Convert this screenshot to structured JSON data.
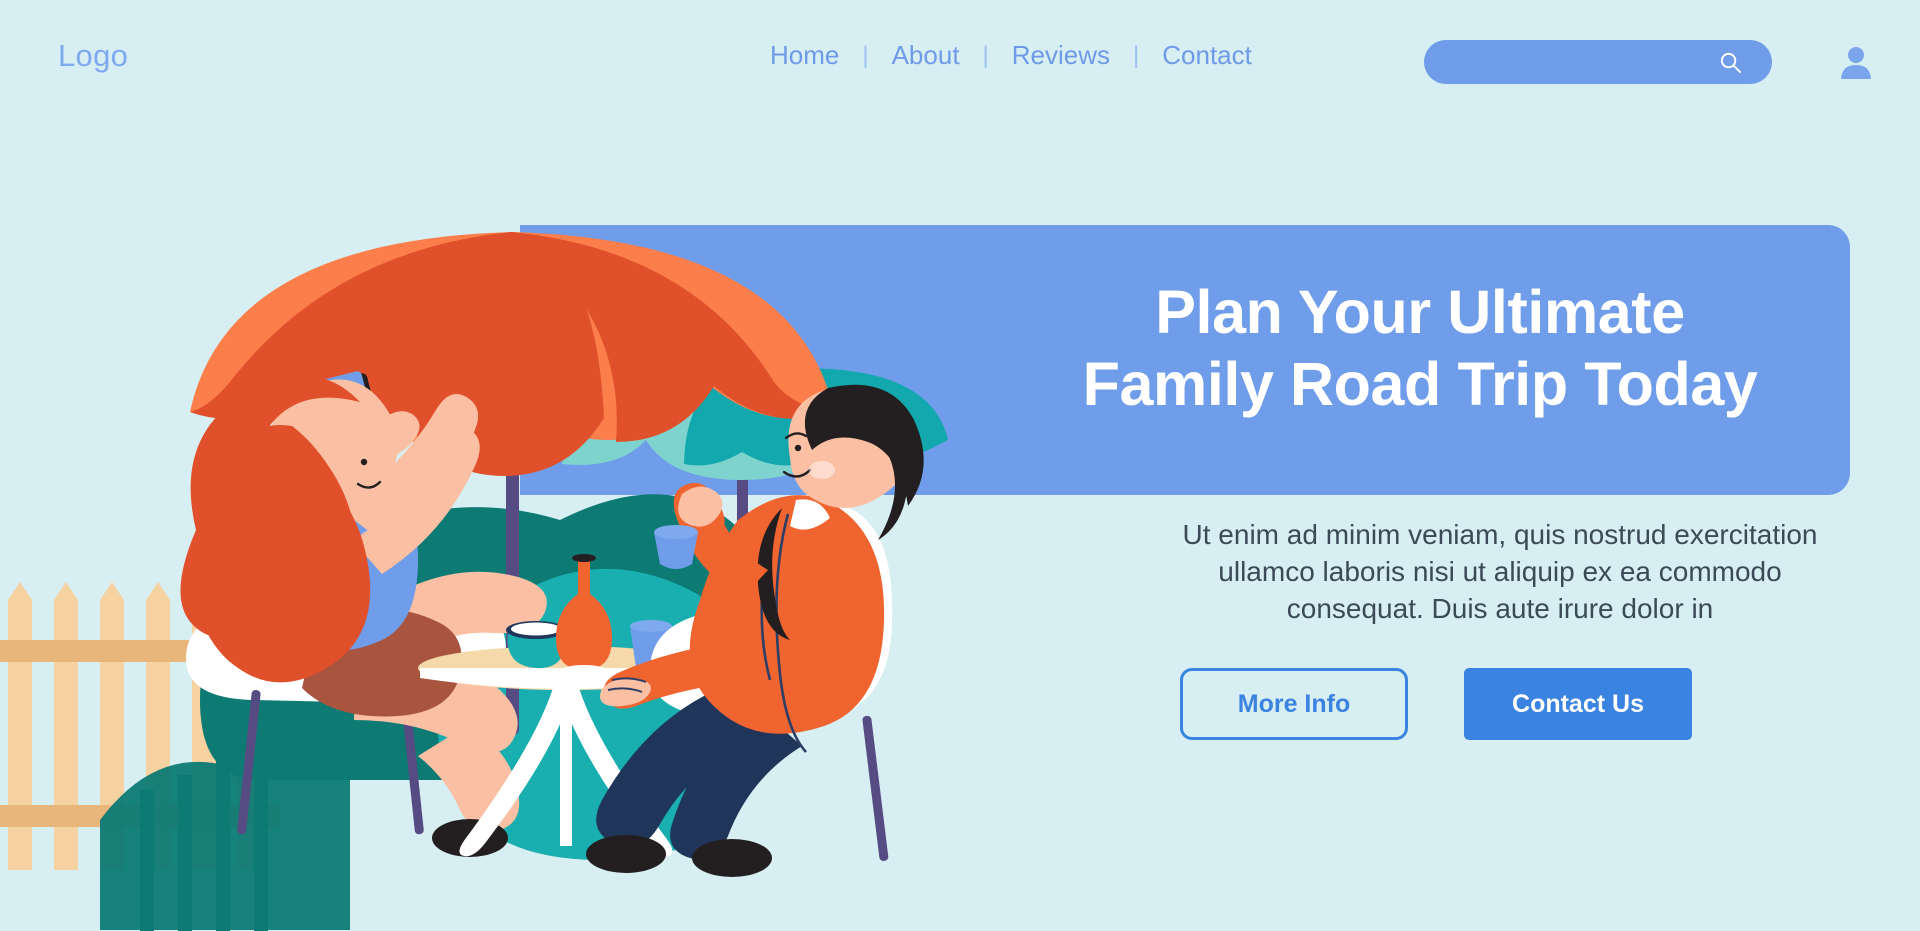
{
  "page": {
    "background_color": "#d7eff2"
  },
  "header": {
    "logo": "Logo",
    "nav": [
      {
        "label": "Home"
      },
      {
        "label": "About"
      },
      {
        "label": "Reviews"
      },
      {
        "label": "Contact"
      }
    ],
    "separator": "|",
    "search": {
      "value": "",
      "placeholder": "",
      "icon": "search-icon",
      "background_color": "#6f9dea"
    },
    "account": {
      "icon": "user-account-icon",
      "color": "#7aa5ec"
    },
    "link_color": "#6e9ae8",
    "logo_color": "#7fa9ee"
  },
  "hero": {
    "headline": "Plan Your Ultimate Family Road Trip Today",
    "headline_line_1": "Plan Your Ultimate",
    "headline_line_2": "Family Road Trip Today",
    "panel_color": "#6f9dea",
    "headline_color": "#ffffff",
    "body": "Ut enim ad minim veniam, quis nostrud exercitation ullamco laboris nisi ut aliquip ex ea commodo consequat. Duis aute irure dolor in",
    "body_color": "#3b4a57",
    "buttons": {
      "primary_label": "Contact Us",
      "primary_color": "#3b83e0",
      "secondary_label": "More Info",
      "secondary_color": "#3b83e0"
    }
  },
  "illustration": {
    "name": "outdoor-cafe-couple-illustration",
    "description": "Woman with red hair using a phone and a man in an orange jacket drinking from a cup at a small round cafe table under umbrellas",
    "colors": {
      "orange_umbrella_dark": "#e0502a",
      "orange_umbrella_light": "#fb7e4b",
      "teal_umbrella_dark": "#12a8ad",
      "teal_umbrella_light": "#7fd3cf",
      "bush_teal": "#0d7a74",
      "bush_teal_light": "#19aeb0",
      "fence_wood": "#f6d2a1",
      "fence_wood_dark": "#e8b57a",
      "chair_white": "#ffffff",
      "pole_purple": "#574b84",
      "skin": "#fbc0a4",
      "hair_red": "#e0502a",
      "top_blue": "#6f9dea",
      "skirt_brown": "#a8543f",
      "jacket_orange": "#f0642f",
      "pants_navy": "#1f3559",
      "hair_black": "#231f20",
      "table_wood": "#f6d9aa",
      "vase_orange": "#f0642f",
      "cup_blue": "#6f9dea",
      "bowl_teal": "#19aeb0"
    }
  }
}
